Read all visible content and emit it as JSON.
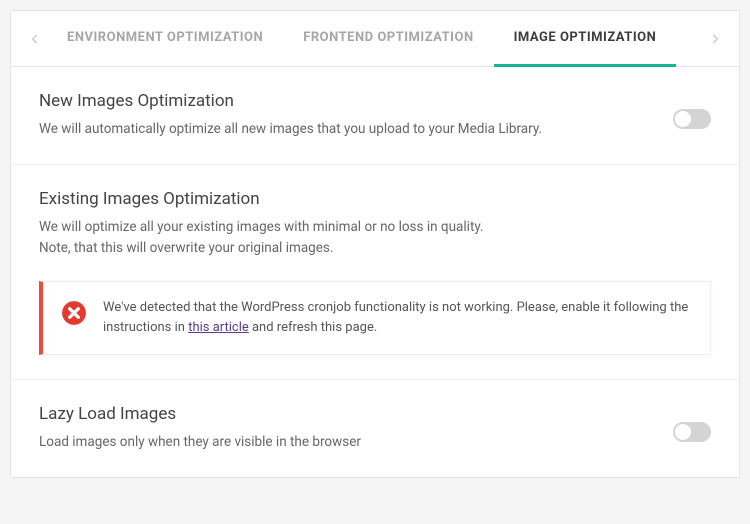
{
  "tabs": {
    "items": [
      {
        "label": "ENVIRONMENT OPTIMIZATION",
        "active": false
      },
      {
        "label": "FRONTEND OPTIMIZATION",
        "active": false
      },
      {
        "label": "IMAGE OPTIMIZATION",
        "active": true
      }
    ]
  },
  "sections": {
    "new_images": {
      "title": "New Images Optimization",
      "desc": "We will automatically optimize all new images that you upload to your Media Library.",
      "enabled": false
    },
    "existing_images": {
      "title": "Existing Images Optimization",
      "desc_line1": "We will optimize all your existing images with minimal or no loss in quality.",
      "desc_line2": "Note, that this will overwrite your original images.",
      "alert": {
        "before": "We've detected that the WordPress cronjob functionality is not working. Please, enable it following the instructions in ",
        "link_text": "this article",
        "after": " and refresh this page."
      }
    },
    "lazy_load": {
      "title": "Lazy Load Images",
      "desc": "Load images only when they are visible in the browser",
      "enabled": false
    }
  }
}
